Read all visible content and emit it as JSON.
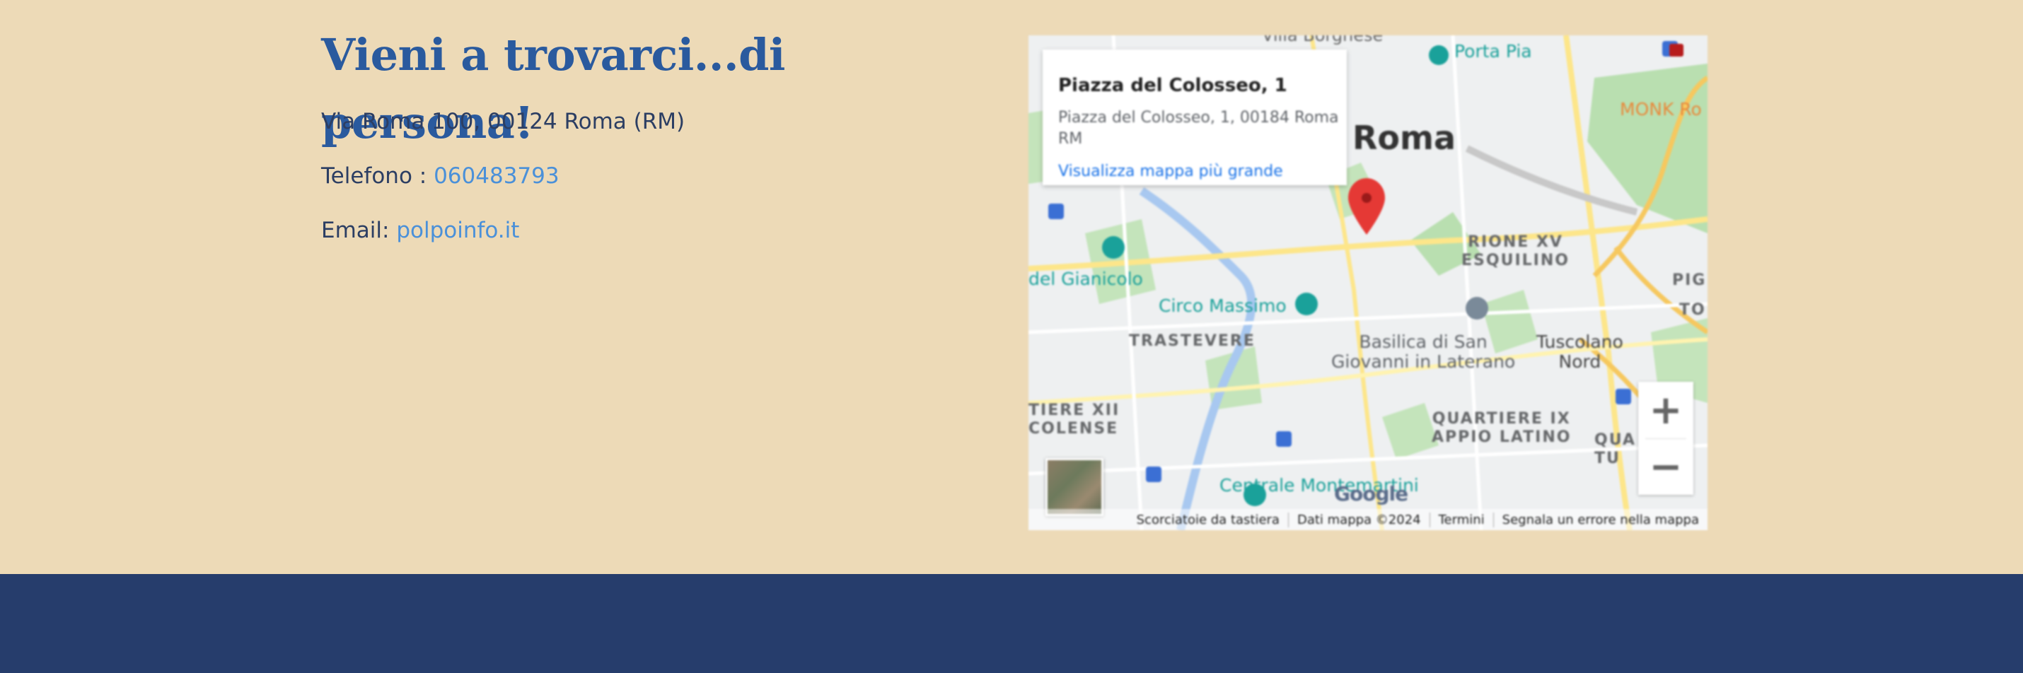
{
  "contact": {
    "heading": "Vieni a trovarci...di persona!",
    "address": "Via Roma 100, 00124 Roma (RM)",
    "phone_label": "Telefono : ",
    "phone_value": "060483793",
    "email_label": "Email: ",
    "email_value": "polpoinfo.it"
  },
  "map": {
    "card": {
      "title": "Piazza del Colosseo, 1",
      "address": "Piazza del Colosseo, 1, 00184 Roma RM",
      "link": "Visualizza mappa più grande"
    },
    "labels": {
      "villa_borghese": "Villa Borghese",
      "porta_pia": "Porta Pia",
      "roma": "Roma",
      "monk": "MONK Ro",
      "rione_xv": "RIONE XV",
      "esquilino": "ESQUILINO",
      "gianicolo": "del Gianicolo",
      "circo_massimo": "Circo Massimo",
      "trastevere": "TRASTEVERE",
      "basilica_1": "Basilica di San",
      "basilica_2": "Giovanni in Laterano",
      "tuscolano_1": "Tuscolano",
      "tuscolano_2": "Nord",
      "pign": "PIGN",
      "to": "TO",
      "quartiere_xii_1": "TIERE XII",
      "quartiere_xii_2": "COLENSE",
      "quartiere_ix_1": "QUARTIERE IX",
      "quartiere_ix_2": "APPIO LATINO",
      "qua_1": "QUA",
      "qua_2": "TU",
      "centrale": "Centrale Montemartini"
    },
    "zoom_in": "+",
    "zoom_out": "−",
    "google": "Google",
    "attribution": {
      "shortcuts": "Scorciatoie da tastiera",
      "data": "Dati mappa ©2024",
      "terms": "Termini",
      "report": "Segnala un errore nella mappa"
    },
    "colors": {
      "park": "#b9dfb0",
      "road": "#fde68a",
      "water": "#a8c8f0",
      "pin": "#e53935"
    }
  }
}
